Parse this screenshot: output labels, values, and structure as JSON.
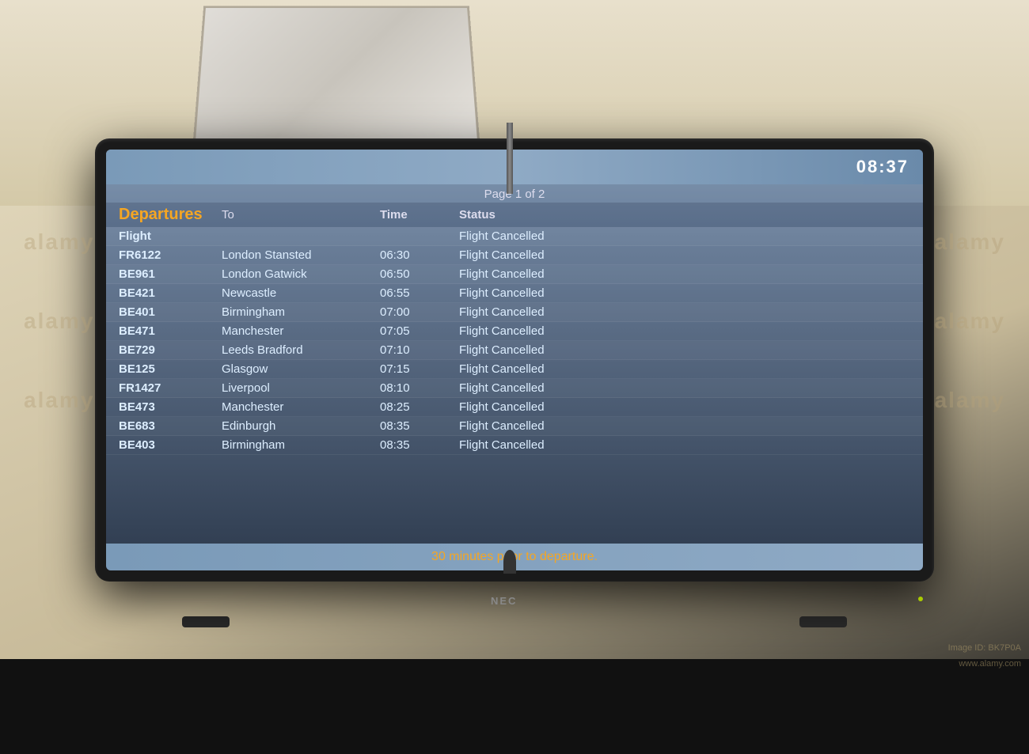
{
  "page": {
    "background_top": "#e8e0cc",
    "background_bottom": "#111"
  },
  "screen": {
    "clock": "08:37",
    "page_indicator": "Page 1 of 2",
    "headers": {
      "departures": "Departures",
      "to": "To",
      "time": "Time",
      "status": "Status"
    },
    "flights": [
      {
        "flight": "Flight",
        "to": "",
        "time": "",
        "status": "Flight Cancelled"
      },
      {
        "flight": "FR6122",
        "to": "London Stansted",
        "time": "06:30",
        "status": "Flight Cancelled"
      },
      {
        "flight": "BE961",
        "to": "London Gatwick",
        "time": "06:50",
        "status": "Flight Cancelled"
      },
      {
        "flight": "BE421",
        "to": "Newcastle",
        "time": "06:55",
        "status": "Flight Cancelled"
      },
      {
        "flight": "BE401",
        "to": "Birmingham",
        "time": "07:00",
        "status": "Flight Cancelled"
      },
      {
        "flight": "BE471",
        "to": "Manchester",
        "time": "07:05",
        "status": "Flight Cancelled"
      },
      {
        "flight": "BE729",
        "to": "Leeds Bradford",
        "time": "07:10",
        "status": "Flight Cancelled"
      },
      {
        "flight": "BE125",
        "to": "Glasgow",
        "time": "07:15",
        "status": "Flight Cancelled"
      },
      {
        "flight": "FR1427",
        "to": "Liverpool",
        "time": "08:10",
        "status": "Flight Cancelled"
      },
      {
        "flight": "BE473",
        "to": "Manchester",
        "time": "08:25",
        "status": "Flight Cancelled"
      },
      {
        "flight": "BE683",
        "to": "Edinburgh",
        "time": "08:35",
        "status": "Flight Cancelled"
      },
      {
        "flight": "BE403",
        "to": "Birmingham",
        "time": "08:35",
        "status": "Flight Cancelled"
      }
    ],
    "footer": "30 minutes prior to departure.",
    "brand": "NEC"
  },
  "watermarks": {
    "alamy": "alamy",
    "image_id": "Image ID: BK7P0A",
    "alamy_url": "www.alamy.com"
  }
}
